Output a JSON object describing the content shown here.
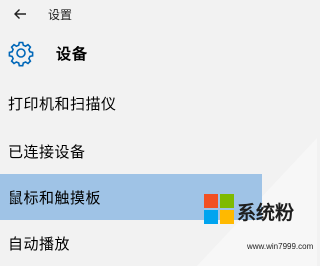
{
  "window": {
    "title": "设置",
    "back_icon": "arrow-left-icon"
  },
  "header": {
    "icon": "gear-icon",
    "title": "设备",
    "accent_color": "#0067b8"
  },
  "nav": {
    "items": [
      {
        "label": "打印机和扫描仪",
        "selected": false
      },
      {
        "label": "已连接设备",
        "selected": false
      },
      {
        "label": "鼠标和触摸板",
        "selected": true
      },
      {
        "label": "自动播放",
        "selected": false
      }
    ],
    "selected_color": "#9fc3e6"
  },
  "watermark": {
    "brand": "系统粉",
    "url": "www.win7999.com",
    "logo_colors": [
      "#f25022",
      "#7fba00",
      "#00a4ef",
      "#ffb900"
    ]
  }
}
